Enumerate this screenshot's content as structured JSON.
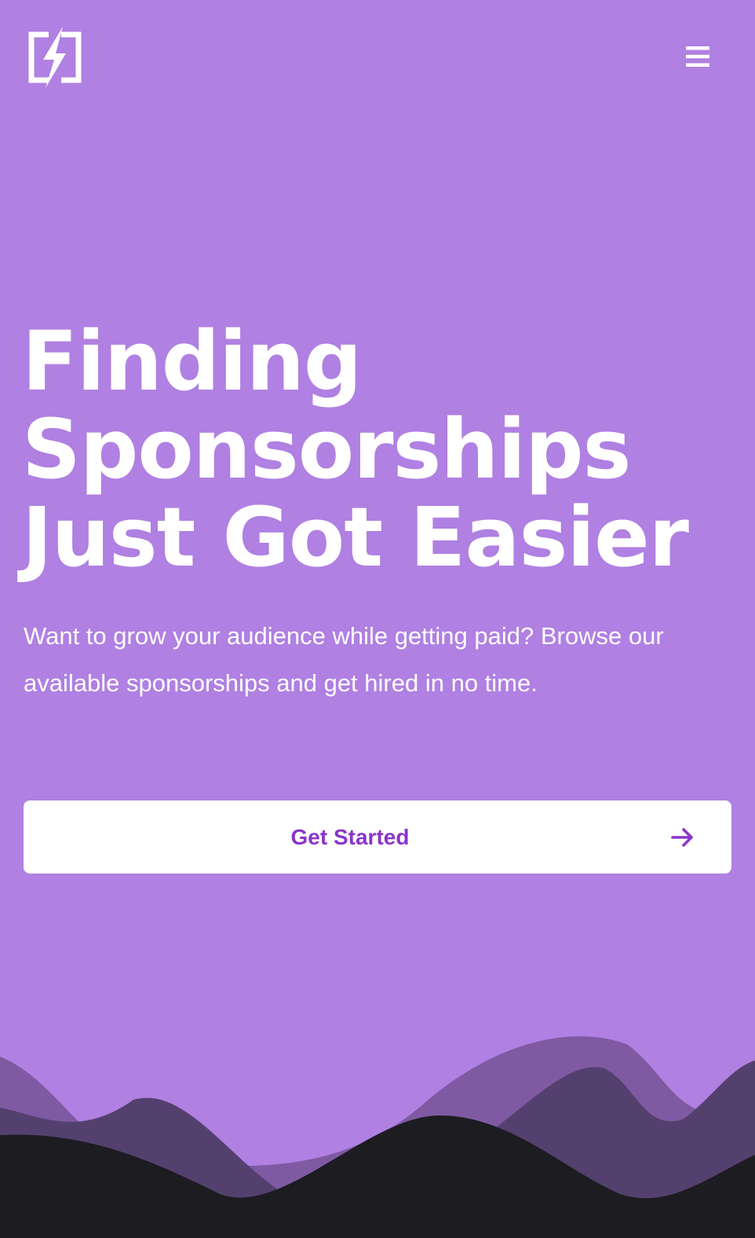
{
  "header": {
    "logo_icon": "bolt-bracket-logo-icon",
    "menu_icon": "hamburger-menu-icon"
  },
  "hero": {
    "headline_lines": [
      "Finding",
      "Sponsorships",
      "Just Got Easier"
    ],
    "subtitle": "Want to grow your audience while getting paid? Browse our available sponsorships and get hired in no time.",
    "cta_label": "Get Started",
    "cta_icon": "arrow-right-icon"
  },
  "colors": {
    "background": "#b080e2",
    "text": "#ffffff",
    "button_background": "#ffffff",
    "button_text": "#8a35c9",
    "wave_light": "#7f5aa3",
    "wave_mid": "#54406e",
    "wave_dark": "#1c1c21"
  }
}
